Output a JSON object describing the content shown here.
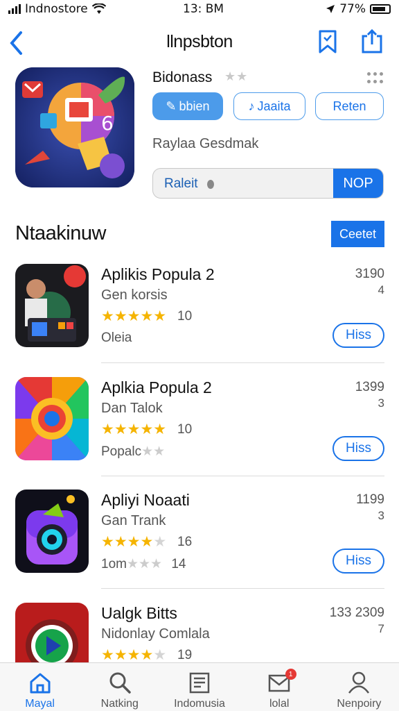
{
  "status_bar": {
    "carrier": "Indnostore",
    "time": "13: BM",
    "battery": "77%"
  },
  "nav": {
    "title": "llnpsbton"
  },
  "hero": {
    "name": "Bidonass",
    "stars": "★★",
    "pills": [
      {
        "label": "bbien",
        "icon": "✎"
      },
      {
        "label": "Jaaita",
        "icon": "♪"
      },
      {
        "label": "Reten",
        "icon": ""
      }
    ],
    "subtitle": "Raylaa Gesdmak",
    "search_placeholder": "Raleit",
    "search_button": "NOP"
  },
  "section": {
    "title": "Ntaakinuw",
    "button": "Ceetet"
  },
  "apps": [
    {
      "title": "Aplikis Popula 2",
      "subtitle": "Gen korsis",
      "stars_on": 5,
      "rating": "10",
      "info": "Oleia",
      "num1": "3190",
      "num2": "4",
      "button": "Hiss",
      "icon": "photo"
    },
    {
      "title": "Aplkia Popula 2",
      "subtitle": "Dan Talok",
      "stars_on": 5,
      "rating": "10",
      "info": "Popalc",
      "info_stars": 2,
      "num1": "1399",
      "num2": "3",
      "button": "Hiss",
      "icon": "chrome"
    },
    {
      "title": "Apliyi Noaati",
      "subtitle": "Gan Trank",
      "stars_on": 4,
      "rating": "16",
      "info": "1om",
      "info_stars": 3,
      "info_rating": "14",
      "num1": "1199",
      "num2": "3",
      "button": "Hiss",
      "icon": "camera"
    },
    {
      "title": "Ualgk Bitts",
      "subtitle": "Nidonlay Comlala",
      "stars_on": 4,
      "rating": "19",
      "num1": "133 2309",
      "num2": "7",
      "icon": "play"
    }
  ],
  "tabs": [
    {
      "label": "Mayal",
      "icon": "home-icon",
      "active": true
    },
    {
      "label": "Natking",
      "icon": "search-icon"
    },
    {
      "label": "Indomusia",
      "icon": "news-icon"
    },
    {
      "label": "lolal",
      "icon": "mail-icon",
      "badge": "1"
    },
    {
      "label": "Nenpoiry",
      "icon": "person-icon"
    }
  ],
  "colors": {
    "accent": "#1a73e8",
    "star": "#f5b400"
  }
}
